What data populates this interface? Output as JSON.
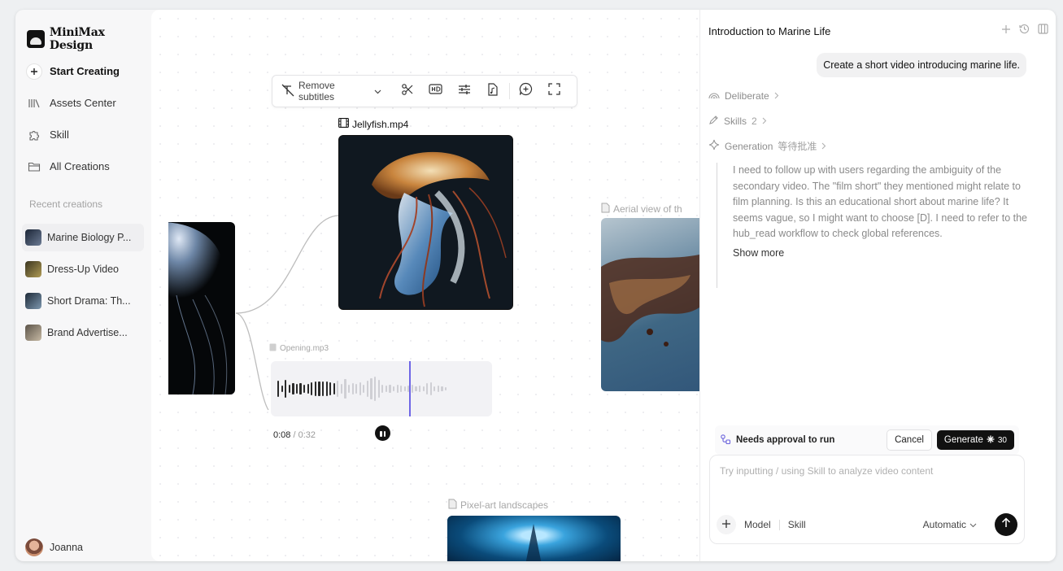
{
  "brand": {
    "name": "MiniMax Design"
  },
  "nav": [
    {
      "label": "Start Creating",
      "icon": "plus-icon"
    },
    {
      "label": "Assets Center",
      "icon": "library-icon"
    },
    {
      "label": "Skill",
      "icon": "puzzle-icon"
    },
    {
      "label": "All Creations",
      "icon": "folder-icon"
    }
  ],
  "recent": {
    "title": "Recent creations",
    "items": [
      {
        "label": "Marine Biology P...",
        "color": "#2d3d55"
      },
      {
        "label": "Dress-Up Video",
        "color": "#5a5130"
      },
      {
        "label": "Short Drama: Th...",
        "color": "#324456"
      },
      {
        "label": "Brand Advertise...",
        "color": "#7b7468"
      }
    ]
  },
  "user": {
    "name": "Joanna"
  },
  "toolbar": {
    "remove_subtitles": "Remove subtitles"
  },
  "canvas": {
    "main_video": "Jellyfish.mp4",
    "audio_name": "Opening.mp3",
    "aerial_label": "Aerial view of th",
    "pixel_label": "Pixel-art landscapes",
    "time_current": "0:08",
    "time_total": "0:32",
    "audio_progress": 0.25
  },
  "panel": {
    "title": "Introduction to Marine Life",
    "user_message": "Create a short video introducing marine life.",
    "steps": {
      "deliberate": "Deliberate",
      "skills": "Skills",
      "skills_count": "2",
      "generation": "Generation",
      "generation_status": "等待批准"
    },
    "reasoning": "I need to follow up with users regarding the ambiguity of the secondary video. The \"film short\" they mentioned might relate to film planning. Is this an educational short about marine life? It seems vague, so I might want to choose [D]. I need to refer to the hub_read workflow to check global references.",
    "show_more": "Show more",
    "approval": {
      "text": "Needs approval to run",
      "cancel": "Cancel",
      "generate": "Generate",
      "credits": "30"
    },
    "composer": {
      "placeholder": "Try inputting / using Skill to analyze video content",
      "model": "Model",
      "skill": "Skill",
      "mode": "Automatic"
    }
  }
}
